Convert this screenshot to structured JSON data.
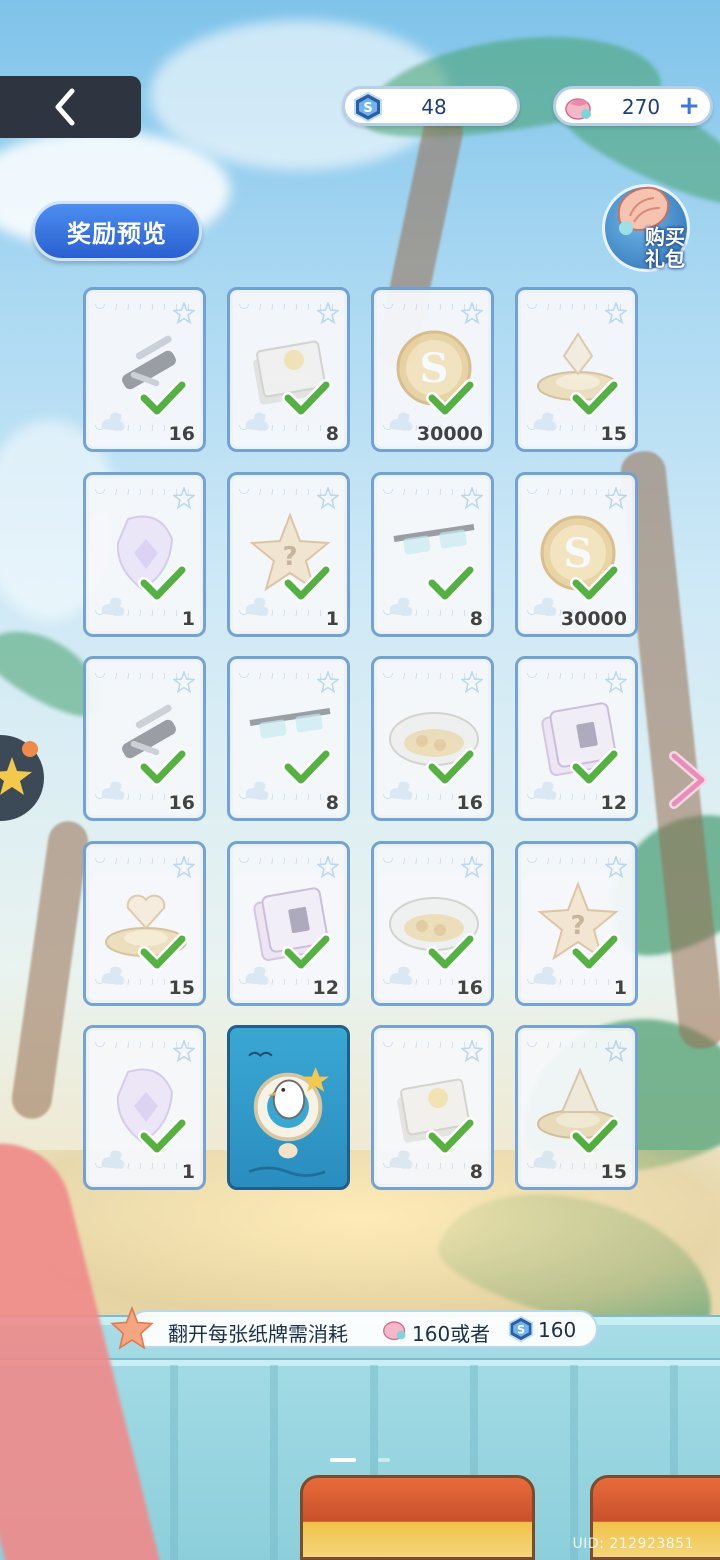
{
  "header": {
    "gem_count": "48",
    "shell_count": "270",
    "plus_label": "+"
  },
  "buttons": {
    "reward_preview": "奖励预览",
    "buy_gift_line1": "购买",
    "buy_gift_line2": "礼包"
  },
  "cards": [
    {
      "item": "knife",
      "qty": "16",
      "claimed": true
    },
    {
      "item": "book",
      "qty": "8",
      "claimed": true
    },
    {
      "item": "coin",
      "qty": "30000",
      "claimed": true
    },
    {
      "item": "diamond-stand",
      "qty": "15",
      "claimed": true
    },
    {
      "item": "crystal",
      "qty": "1",
      "claimed": true
    },
    {
      "item": "mystery-star",
      "qty": "1",
      "claimed": true
    },
    {
      "item": "glasses",
      "qty": "8",
      "claimed": true
    },
    {
      "item": "coin",
      "qty": "30000",
      "claimed": true
    },
    {
      "item": "knife",
      "qty": "16",
      "claimed": true
    },
    {
      "item": "glasses",
      "qty": "8",
      "claimed": true
    },
    {
      "item": "food-dish",
      "qty": "16",
      "claimed": true
    },
    {
      "item": "card-pack",
      "qty": "12",
      "claimed": true
    },
    {
      "item": "heart-stand",
      "qty": "15",
      "claimed": true
    },
    {
      "item": "card-pack",
      "qty": "12",
      "claimed": true
    },
    {
      "item": "food-dish",
      "qty": "16",
      "claimed": true
    },
    {
      "item": "mystery-star",
      "qty": "1",
      "claimed": true
    },
    {
      "item": "crystal",
      "qty": "1",
      "claimed": true
    },
    {
      "item": "seagull-card-back",
      "qty": "",
      "claimed": false
    },
    {
      "item": "book",
      "qty": "8",
      "claimed": true
    },
    {
      "item": "sail-stand",
      "qty": "15",
      "claimed": true
    }
  ],
  "cost": {
    "prefix": "翻开每张纸牌需消耗",
    "shell_cost": "160或者",
    "gem_cost": "160"
  },
  "uid": "UID: 212923851",
  "icons": {
    "back": "chevron-left-icon",
    "gem": "s-gem-icon",
    "shell": "conch-shell-icon",
    "check": "check-icon",
    "next": "chevron-right-icon"
  },
  "colors": {
    "accent": "#2a5fd0",
    "check": "#4fae3a",
    "card_border": "#6f9fd2"
  }
}
